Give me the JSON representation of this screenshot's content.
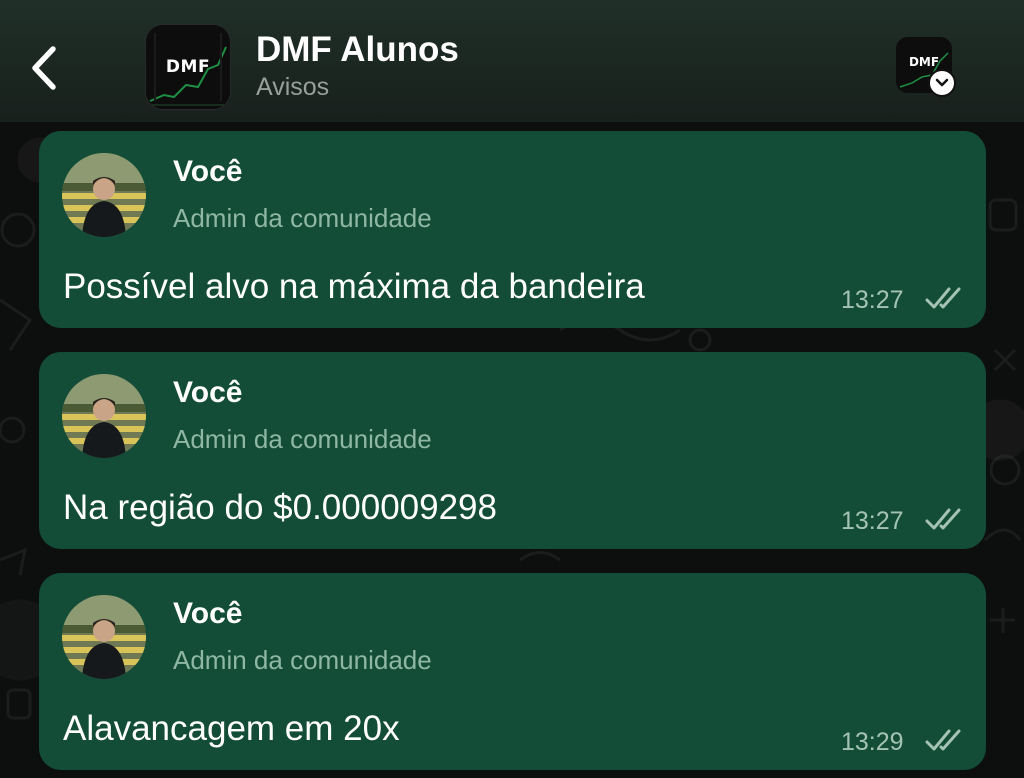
{
  "header": {
    "title": "DMF Alunos",
    "subtitle": "Avisos",
    "group_logo_text": "DMF",
    "community_logo_text": "DMF"
  },
  "messages": [
    {
      "sender": "Você",
      "role": "Admin da comunidade",
      "text": "Possível alvo na máxima da bandeira",
      "time": "13:27",
      "status": "read"
    },
    {
      "sender": "Você",
      "role": "Admin da comunidade",
      "text": "Na região do $0.000009298",
      "time": "13:27",
      "status": "read"
    },
    {
      "sender": "Você",
      "role": "Admin da comunidade",
      "text": "Alavancagem em 20x",
      "time": "13:29",
      "status": "read"
    }
  ],
  "icons": {
    "back": "chevron-left-icon",
    "read_status": "double-check-icon",
    "community_menu": "chevron-down-icon"
  },
  "colors": {
    "bubble": "#134d37",
    "header": "#1b2621",
    "background": "#0d0f0e"
  }
}
